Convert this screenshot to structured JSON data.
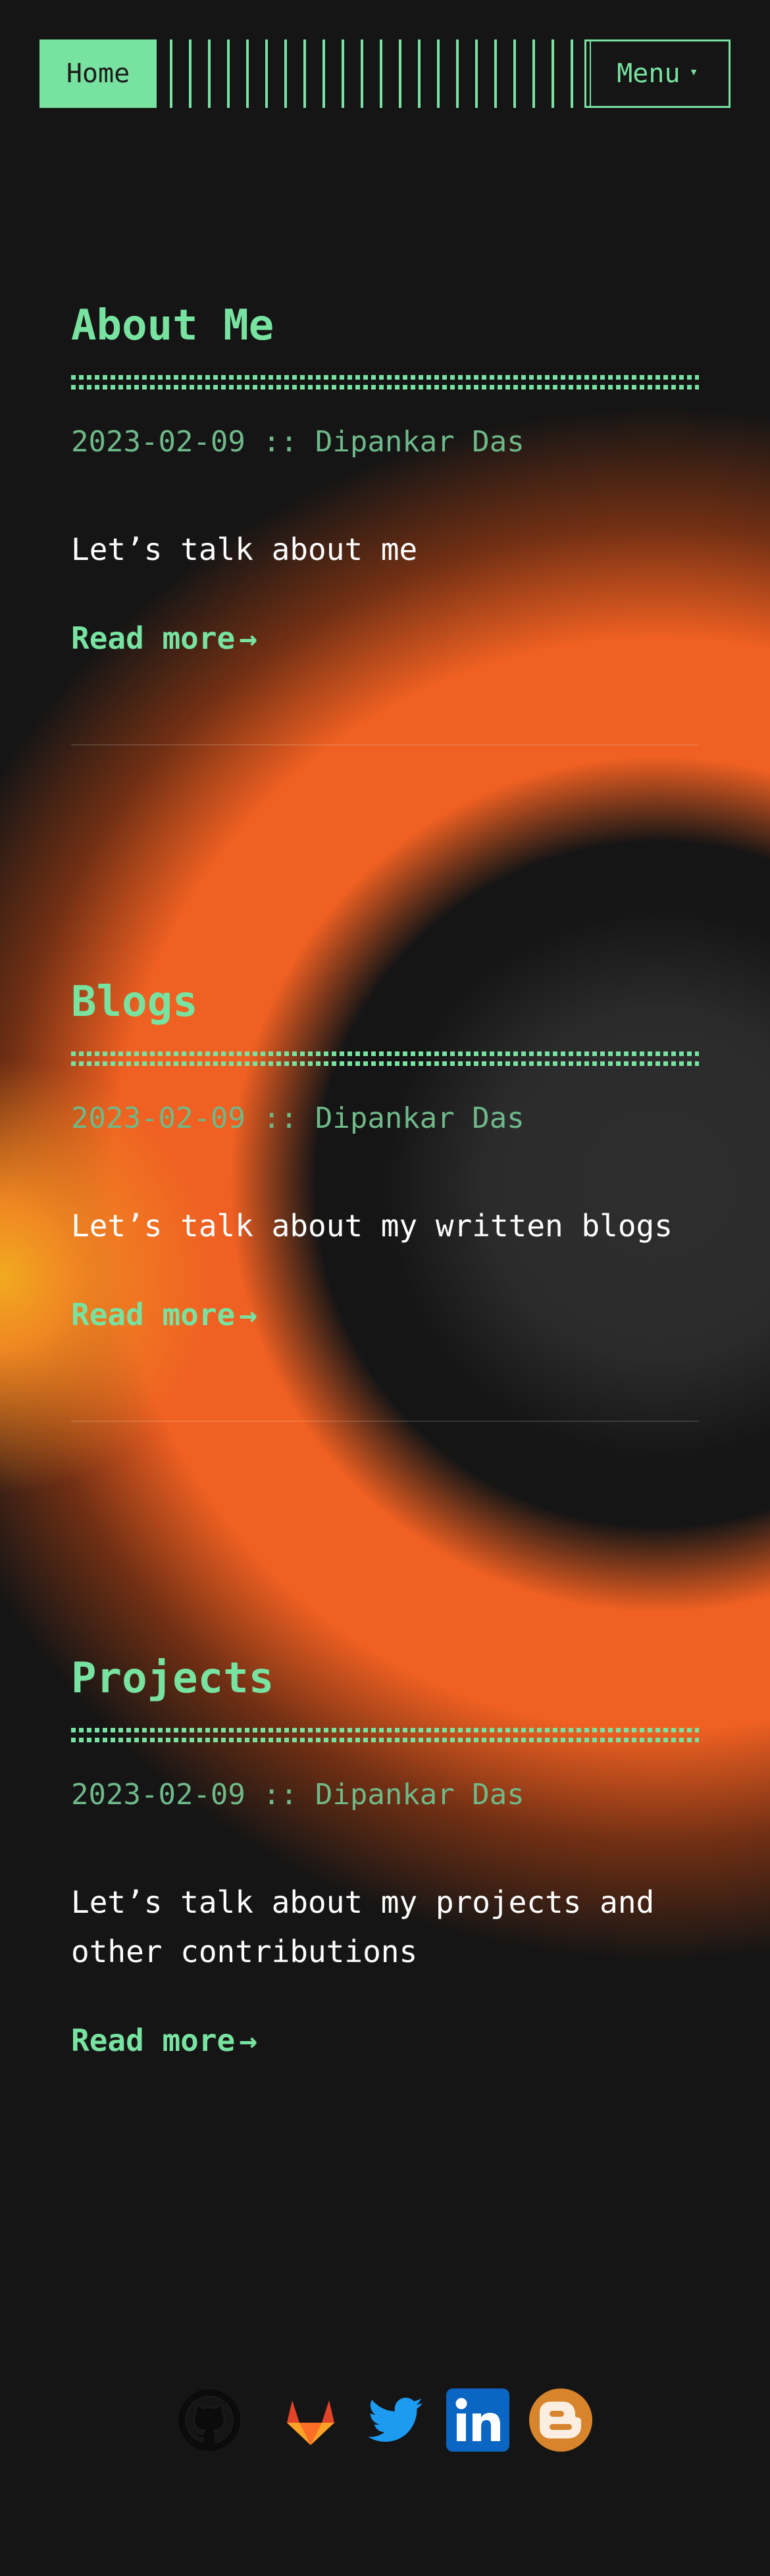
{
  "header": {
    "logo_label": "Home",
    "menu_label": "Menu",
    "menu_arrow": "▾",
    "accent_color": "#78e2a0"
  },
  "posts": [
    {
      "title": "About Me",
      "meta": "2023-02-09 :: Dipankar Das",
      "excerpt": "Let’s talk about me",
      "read_more": "Read more",
      "arrow": "→"
    },
    {
      "title": "Blogs",
      "meta": "2023-02-09 :: Dipankar Das",
      "excerpt": "Let’s talk about my written blogs",
      "read_more": "Read more",
      "arrow": "→"
    },
    {
      "title": "Projects",
      "meta": "2023-02-09 :: Dipankar Das",
      "excerpt": "Let’s talk about my projects and other contributions",
      "read_more": "Read more",
      "arrow": "→"
    }
  ],
  "social": {
    "icons": [
      "github-icon",
      "gitlab-icon",
      "twitter-icon",
      "linkedin-icon",
      "blogger-icon"
    ]
  }
}
